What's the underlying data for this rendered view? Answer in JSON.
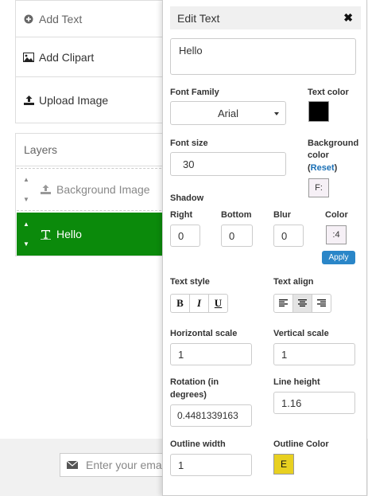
{
  "menu": {
    "add_text": "Add Text",
    "add_clipart": "Add Clipart",
    "upload_image": "Upload Image"
  },
  "layers": {
    "header": "Layers",
    "items": [
      {
        "label": "Background Image",
        "icon": "upload-icon"
      },
      {
        "label": "Hello",
        "icon": "text-icon",
        "active": true
      }
    ]
  },
  "footer": {
    "email_placeholder": "Enter your ema"
  },
  "edit_text": {
    "title": "Edit Text",
    "text_value": "Hello",
    "font_family_label": "Font Family",
    "font_family_value": "Arial",
    "text_color_label": "Text color",
    "text_color": "#000000",
    "font_size_label": "Font size",
    "font_size_value": "30",
    "background_color_label_1": "Background",
    "background_color_label_2": "color",
    "reset_prefix": "(",
    "reset_label": "Reset",
    "reset_suffix": ")",
    "background_swatch_text": "F:",
    "shadow_label": "Shadow",
    "shadow_right_label": "Right",
    "shadow_right_value": "0",
    "shadow_bottom_label": "Bottom",
    "shadow_bottom_value": "0",
    "shadow_blur_label": "Blur",
    "shadow_blur_value": "0",
    "shadow_color_label": "Color",
    "shadow_color_text": ":4",
    "apply_label": "Apply",
    "text_style_label": "Text style",
    "text_style_buttons": [
      "B",
      "I",
      "U"
    ],
    "text_align_label": "Text align",
    "horizontal_scale_label": "Horizontal scale",
    "horizontal_scale_value": "1",
    "vertical_scale_label": "Vertical scale",
    "vertical_scale_value": "1",
    "rotation_label_1": "Rotation (in",
    "rotation_label_2": "degrees)",
    "rotation_value": "0.4481339163",
    "line_height_label": "Line height",
    "line_height_value": "1.16",
    "outline_width_label": "Outline width",
    "outline_width_value": "1",
    "outline_color_label": "Outline Color",
    "outline_color_text": "E",
    "outline_color": "#e8d020",
    "active_layer_color": "#0b8a0b",
    "apply_color": "#2a86c8"
  }
}
